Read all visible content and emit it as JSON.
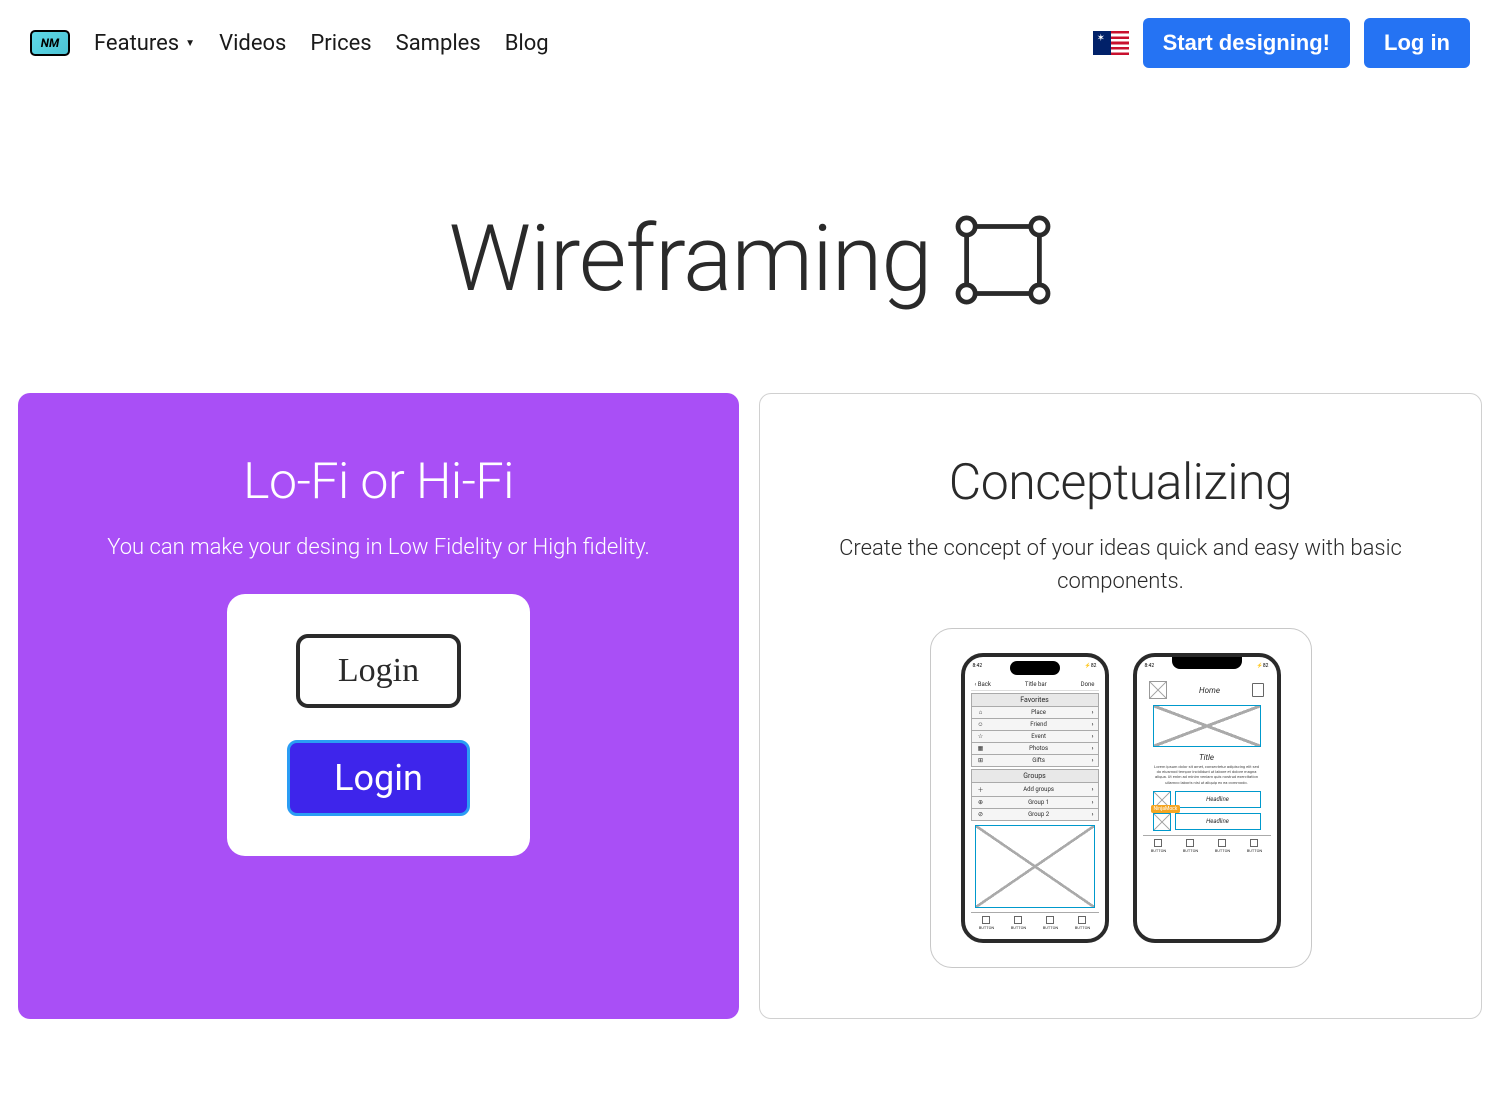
{
  "nav": {
    "features": "Features",
    "videos": "Videos",
    "prices": "Prices",
    "samples": "Samples",
    "blog": "Blog",
    "startDesigning": "Start designing!",
    "login": "Log in"
  },
  "hero": {
    "title": "Wireframing"
  },
  "cards": {
    "lofi": {
      "title": "Lo-Fi or Hi-Fi",
      "desc": "You can make your desing in Low Fidelity or High fidelity.",
      "loginSketch": "Login",
      "loginSolid": "Login"
    },
    "concept": {
      "title": "Conceptualizing",
      "desc": "Create the concept of your ideas quick and easy with basic components."
    }
  },
  "phone1": {
    "time": "8:42",
    "signal": "⚡82",
    "back": "‹ Back",
    "titleBar": "Title bar",
    "done": "Done",
    "favorites": "Favorites",
    "rows": [
      {
        "icon": "⌂",
        "label": "Place"
      },
      {
        "icon": "☺",
        "label": "Friend"
      },
      {
        "icon": "☆",
        "label": "Event"
      },
      {
        "icon": "▦",
        "label": "Photos"
      },
      {
        "icon": "⊞",
        "label": "Gifts"
      }
    ],
    "groups": "Groups",
    "groupRows": [
      {
        "icon": "＋",
        "label": "Add groups"
      },
      {
        "icon": "⊕",
        "label": "Group 1"
      },
      {
        "icon": "⊘",
        "label": "Group 2"
      }
    ],
    "button": "BUTTON"
  },
  "phone2": {
    "time": "8:42",
    "signal": "⚡82",
    "home": "Home",
    "title": "Title",
    "lorem": "Lorem ipsum dolor sit amet, consectetur adipiscing elit sed do eiusmod tempor incididunt ut labore et dolore magna aliqua. Ut enim ad minim veniam quis nostrud exercitation ullamco laboris nisi ut aliquip ex ea commodo.",
    "headline": "Headline",
    "badge": "NinjaMock",
    "button": "BUTTON"
  }
}
